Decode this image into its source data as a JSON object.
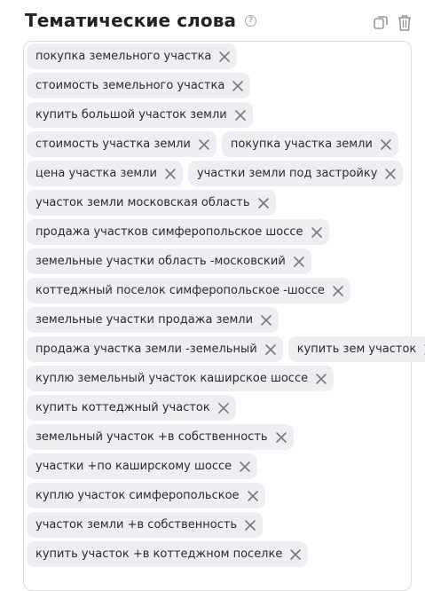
{
  "header": {
    "title": "Тематические слова",
    "help_glyph": "?"
  },
  "icons": {
    "copy": "copy-icon",
    "trash": "trash-icon",
    "remove": "close-icon",
    "help": "question-icon"
  },
  "keyword_rows": [
    [
      "покупка земельного участка"
    ],
    [
      "стоимость земельного участка"
    ],
    [
      "купить большой участок земли"
    ],
    [
      "стоимость участка земли",
      "покупка участка земли"
    ],
    [
      "цена участка земли",
      "участки земли под застройку"
    ],
    [
      "участок земли московская область"
    ],
    [
      "продажа участков симферопольское шоссе"
    ],
    [
      "земельные участки область -московский"
    ],
    [
      "коттеджный поселок симферопольское -шоссе"
    ],
    [
      "земельные участки продажа земли"
    ],
    [
      "продажа участка земли -земельный",
      "купить зем участок"
    ],
    [
      "куплю земельный участок каширское шоссе"
    ],
    [
      "купить коттеджный участок"
    ],
    [
      "земельный участок +в собственность"
    ],
    [
      "участки +по каширскому шоссе"
    ],
    [
      "куплю участок симферопольское"
    ],
    [
      "участок земли +в собственность"
    ],
    [
      "купить участок +в коттеджном поселке"
    ]
  ]
}
